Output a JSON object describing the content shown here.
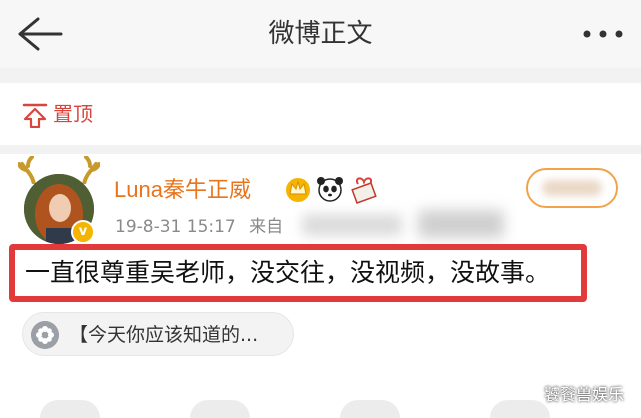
{
  "header": {
    "title": "微博正文",
    "back_icon": "arrow-left-icon",
    "more_icon": "more-dots-icon"
  },
  "pinned": {
    "label": "置顶",
    "icon": "pin-top-icon",
    "color": "#d9453c"
  },
  "post": {
    "author": {
      "name": "Luna秦牛正威",
      "name_color": "#e8741d",
      "verified_badge": "v"
    },
    "date": "19-8-31 15:17",
    "source_prefix": "来自",
    "text": "一直很尊重吴老师，没交往，没视频，没故事。",
    "highlight_color": "#e23a3a",
    "topic": {
      "label": "【今天你应该知道的..."
    }
  },
  "watermark": "饕餮兽娱乐"
}
